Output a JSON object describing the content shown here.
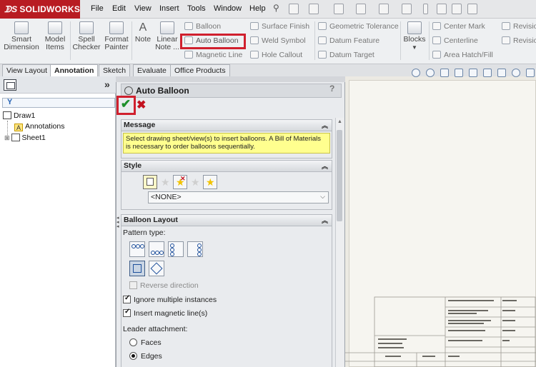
{
  "app": {
    "logo_text": "SOLIDWORKS",
    "brand_color": "#b81c22"
  },
  "menu": [
    "File",
    "Edit",
    "View",
    "Insert",
    "Tools",
    "Window",
    "Help"
  ],
  "ribbon": {
    "large_buttons": [
      {
        "label1": "Smart",
        "label2": "Dimension",
        "icon": "smart-dimension-icon"
      },
      {
        "label1": "Model",
        "label2": "Items",
        "icon": "model-items-icon"
      },
      {
        "label1": "Spell",
        "label2": "Checker",
        "icon": "spell-checker-icon"
      },
      {
        "label1": "Format",
        "label2": "Painter",
        "icon": "format-painter-icon"
      },
      {
        "label1": "Note",
        "label2": "",
        "icon": "note-icon"
      },
      {
        "label1": "Linear",
        "label2": "Note ...",
        "icon": "linear-note-icon"
      }
    ],
    "col_a": [
      "Balloon",
      "Auto Balloon",
      "Magnetic Line"
    ],
    "col_b": [
      "Surface Finish",
      "Weld Symbol",
      "Hole Callout"
    ],
    "col_c": [
      "Geometric Tolerance",
      "Datum Feature",
      "Datum Target"
    ],
    "blocks": "Blocks",
    "col_d": [
      "Center Mark",
      "Centerline",
      "Area Hatch/Fill"
    ],
    "col_e": [
      "Revisio",
      "Revisio"
    ],
    "highlight_color": "#d0202e"
  },
  "tabs": [
    "View Layout",
    "Annotation",
    "Sketch",
    "Evaluate",
    "Office Products"
  ],
  "active_tab": "Annotation",
  "tree": {
    "root": "Draw1",
    "items": [
      "Annotations",
      "Sheet1"
    ]
  },
  "property_manager": {
    "title": "Auto Balloon",
    "help": "?",
    "message": {
      "header": "Message",
      "text": "Select drawing sheet/view(s) to insert balloons. A Bill of Materials is necessary to order balloons sequentially."
    },
    "style": {
      "header": "Style",
      "selected": "<NONE>"
    },
    "balloon_layout": {
      "header": "Balloon Layout",
      "pattern_label": "Pattern type:",
      "reverse_direction": "Reverse direction",
      "ignore_multiple": "Ignore multiple instances",
      "ignore_multiple_checked": true,
      "insert_magnetic": "Insert magnetic line(s)",
      "insert_magnetic_checked": true,
      "leader_attachment_label": "Leader attachment:",
      "leader_options": [
        "Faces",
        "Edges"
      ],
      "leader_selected": "Edges"
    }
  }
}
